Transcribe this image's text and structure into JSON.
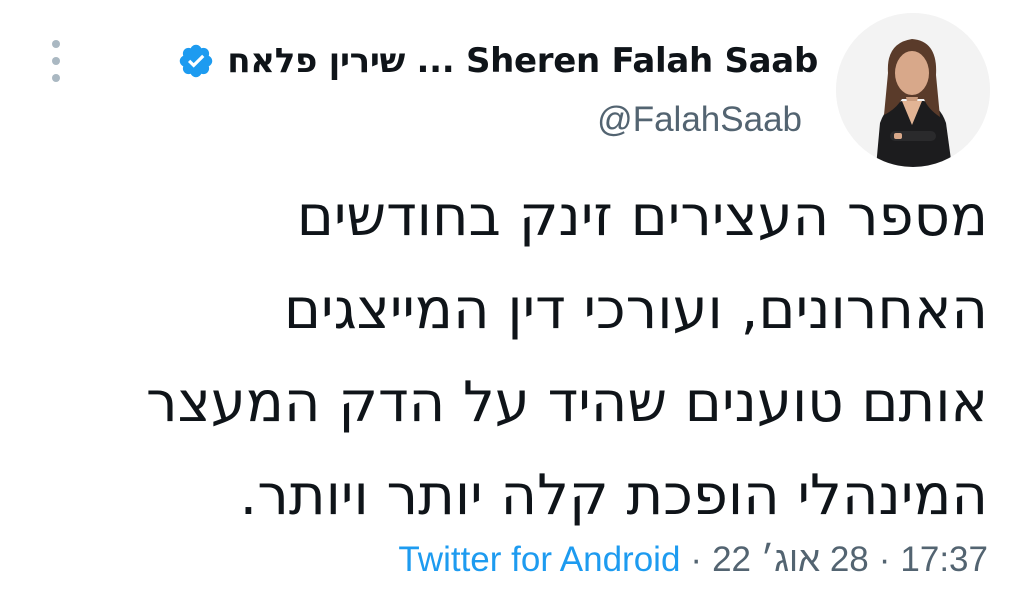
{
  "tweet": {
    "display_name": "שירין פלאח ... Sheren Falah Saab",
    "handle": "@FalahSaab",
    "verified_icon": "verified-badge-icon",
    "more_icon": "more-vertical-icon",
    "text_lines": [
      "מספר העצירים זינק בחודשים",
      "האחרונים, ועורכי דין המייצגים",
      "אותם טוענים שהיד על הדק המעצר",
      "המינהלי הופכת קלה יותר ויותר."
    ],
    "time": "17:37",
    "date": "28 אוג׳ 22",
    "separator": "·",
    "source": "Twitter for Android",
    "colors": {
      "verified": "#1d9bf0",
      "link": "#1d9bf0",
      "secondary": "#536471",
      "text": "#0f1419"
    }
  }
}
